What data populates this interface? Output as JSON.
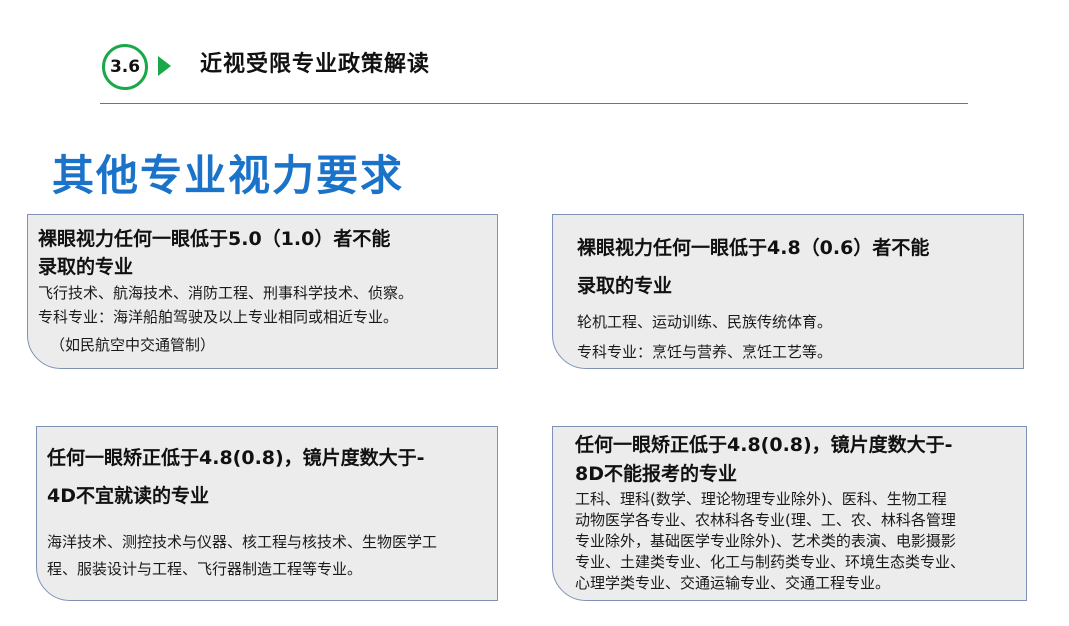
{
  "header": {
    "section_number": "3.6",
    "section_title": "近视受限专业政策解读"
  },
  "main_title": "其他专业视力要求",
  "cards": [
    {
      "heading_lines": [
        "裸眼视力任何一眼低于5.0（1.0）者不能",
        "录取的专业"
      ],
      "body_lines": [
        "飞行技术、航海技术、消防工程、刑事科学技术、侦察。",
        "专科专业：海洋船舶驾驶及以上专业相同或相近专业。",
        "（如民航空中交通管制）"
      ]
    },
    {
      "heading_lines": [
        "裸眼视力任何一眼低于4.8（0.6）者不能",
        "录取的专业"
      ],
      "body_lines": [
        "轮机工程、运动训练、民族传统体育。",
        "专科专业：烹饪与营养、烹饪工艺等。"
      ]
    },
    {
      "heading_lines": [
        "任何一眼矫正低于4.8(0.8)，镜片度数大于-",
        "4D不宜就读的专业"
      ],
      "body_lines": [
        "海洋技术、测控技术与仪器、核工程与核技术、生物医学工",
        "程、服装设计与工程、飞行器制造工程等专业。"
      ]
    },
    {
      "heading_lines": [
        "任何一眼矫正低于4.8(0.8)，镜片度数大于-",
        "8D不能报考的专业"
      ],
      "body_lines": [
        "工科、理科(数学、理论物理专业除外)、医科、生物工程",
        "动物医学各专业、农林科各专业(理、工、农、林科各管理",
        "专业除外，基础医学专业除外)、艺术类的表演、电影摄影",
        "专业、土建类专业、化工与制药类专业、环境生态类专业、",
        "心理学类专业、交通运输专业、交通工程专业。"
      ]
    }
  ]
}
